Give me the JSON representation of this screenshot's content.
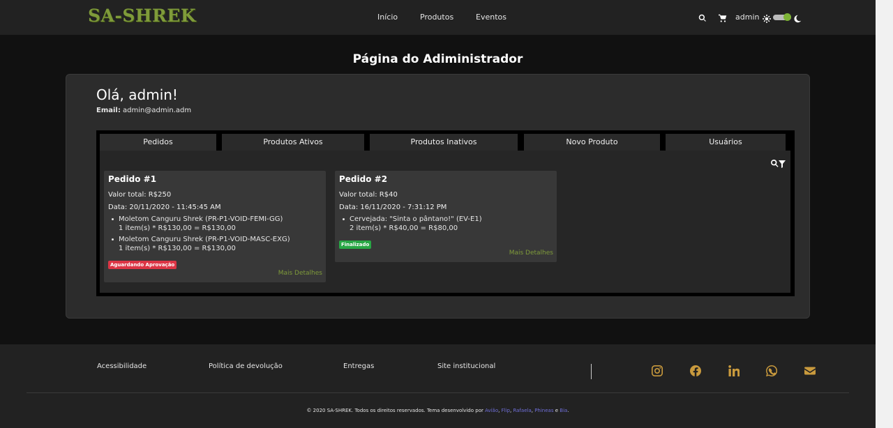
{
  "navbar": {
    "logo": "SA-SHREK",
    "links": [
      "Início",
      "Produtos",
      "Eventos"
    ],
    "user": "admin",
    "icons": [
      "search-icon",
      "cart-icon",
      "sun-icon",
      "moon-icon"
    ],
    "dark_mode": true
  },
  "page": {
    "title": "Página do Adiministrador"
  },
  "admin": {
    "greeting": "Olá, admin!",
    "email_label": "Email:",
    "email": "admin@admin.adm"
  },
  "tabs": [
    "Pedidos",
    "Produtos Ativos",
    "Produtos Inativos",
    "Novo Produto",
    "Usuários"
  ],
  "orders": [
    {
      "title": "Pedido #1",
      "total": "Valor total: R$250",
      "date": "Data: 20/11/2020 - 11:45:45 AM",
      "items": [
        {
          "name": "Moletom Canguru Shrek (PR-P1-VOID-FEMI-GG)",
          "calc": "1 item(s) * R$130,00 = R$130,00"
        },
        {
          "name": "Moletom Canguru Shrek (PR-P1-VOID-MASC-EXG)",
          "calc": "1 item(s) * R$130,00 = R$130,00"
        }
      ],
      "status": "Aguardando Aprovação",
      "status_color": "#dc3545",
      "more": "Mais Detalhes"
    },
    {
      "title": "Pedido #2",
      "total": "Valor total: R$40",
      "date": "Data: 16/11/2020 - 7:31:12 PM",
      "items": [
        {
          "name": "Cervejada: \"Sinta o pântano!\" (EV-E1)",
          "calc": "2 item(s) * R$40,00 = R$80,00"
        }
      ],
      "status": "Finalizado",
      "status_color": "#28a745",
      "more": "Mais Detalhes"
    }
  ],
  "footer": {
    "links": [
      "Acessibilidade",
      "Política de devolução",
      "Entregas",
      "Site institucional"
    ],
    "social_icons": [
      "instagram-icon",
      "facebook-icon",
      "linkedin-icon",
      "whatsapp-icon",
      "email-icon"
    ],
    "copyright_prefix": "© 2020 SA-SHREK. Todos os direitos reservados. Tema desenvolvido por",
    "authors": [
      "Avião",
      "Flip",
      "Rafaela",
      "Phineas",
      "Bia"
    ],
    "sep_comma": ",",
    "sep_and": "e",
    "end": "."
  },
  "colors": {
    "accent": "#7f9b3a",
    "social": "#c99a3d",
    "author_link": "#6f6fd8"
  }
}
